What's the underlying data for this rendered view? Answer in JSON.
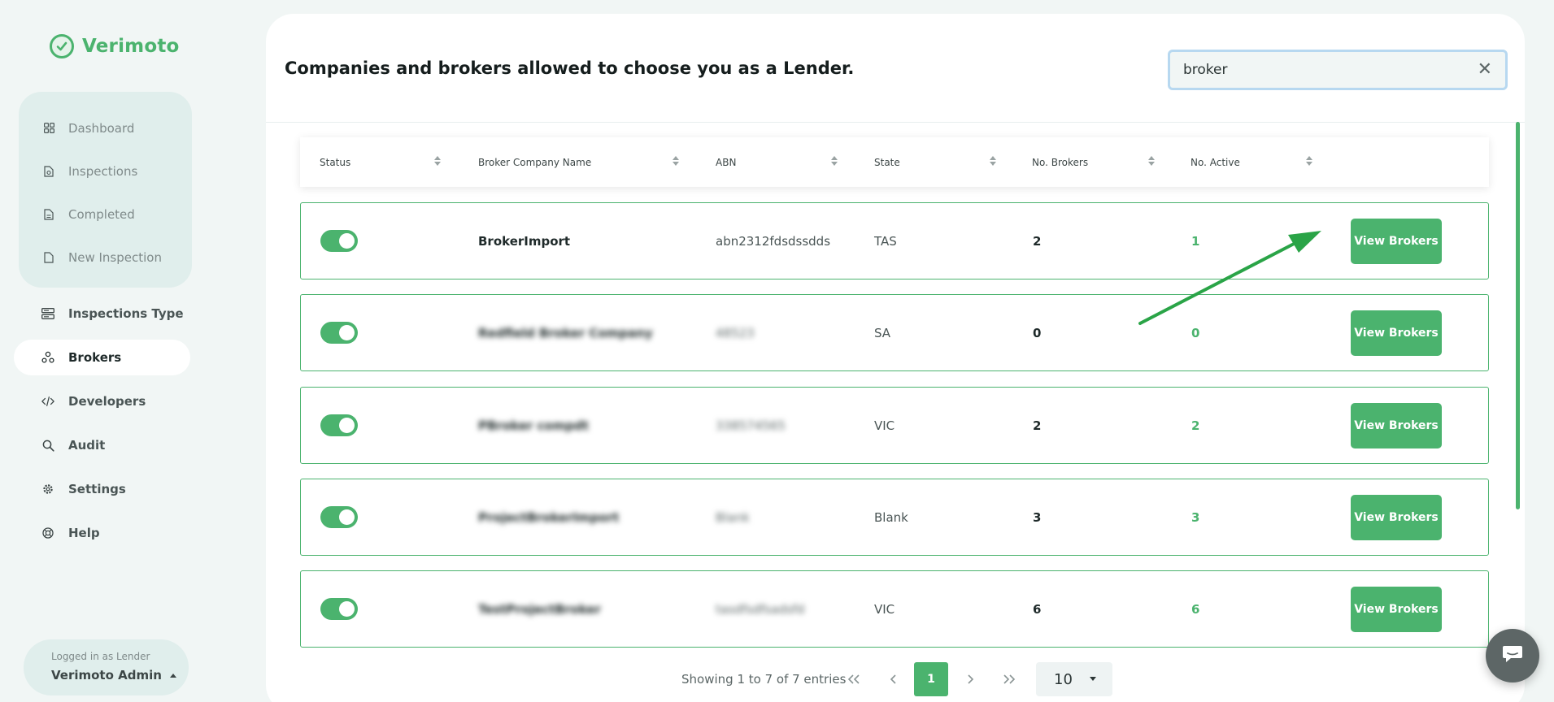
{
  "app": {
    "name": "Verimoto",
    "accent_color": "#4bb36e"
  },
  "sidebar": {
    "sub_items": [
      {
        "label": "Dashboard",
        "icon": "grid-icon"
      },
      {
        "label": "Inspections",
        "icon": "document-icon"
      },
      {
        "label": "Completed",
        "icon": "document-check-icon"
      },
      {
        "label": "New Inspection",
        "icon": "document-plus-icon"
      }
    ],
    "main_items": [
      {
        "label": "Inspections Type",
        "icon": "server-icon"
      },
      {
        "label": "Brokers",
        "icon": "people-icon",
        "active": true
      },
      {
        "label": "Developers",
        "icon": "code-icon"
      },
      {
        "label": "Audit",
        "icon": "search-icon"
      },
      {
        "label": "Settings",
        "icon": "gear-icon"
      },
      {
        "label": "Help",
        "icon": "lifebuoy-icon"
      }
    ],
    "user": {
      "role": "Logged in as Lender",
      "name": "Verimoto Admin"
    }
  },
  "page": {
    "title": "Companies and brokers allowed to choose you as a Lender.",
    "search_value": "broker"
  },
  "table": {
    "columns": [
      "Status",
      "Broker Company Name",
      "ABN",
      "State",
      "No. Brokers",
      "No. Active"
    ],
    "action_label": "View Brokers",
    "rows": [
      {
        "status": true,
        "name": "BrokerImport",
        "abn": "abn2312fdsdssdds",
        "state": "TAS",
        "brokers": "2",
        "active": "1",
        "redacted": false
      },
      {
        "status": true,
        "name": "Redfield Broker Company",
        "abn": "48523",
        "state": "SA",
        "brokers": "0",
        "active": "0",
        "redacted": true
      },
      {
        "status": true,
        "name": "PBroker compdt",
        "abn": "338574565",
        "state": "VIC",
        "brokers": "2",
        "active": "2",
        "redacted": true
      },
      {
        "status": true,
        "name": "ProjectBrokerImport",
        "abn": "Blank",
        "state": "Blank",
        "brokers": "3",
        "active": "3",
        "redacted": true
      },
      {
        "status": true,
        "name": "TestProjectBroker",
        "abn": "tasdfsdfsadsfd",
        "state": "VIC",
        "brokers": "6",
        "active": "6",
        "redacted": true
      }
    ]
  },
  "pagination": {
    "info": "Showing 1 to 7 of 7 entries",
    "current_page": "1",
    "page_size": "10"
  }
}
